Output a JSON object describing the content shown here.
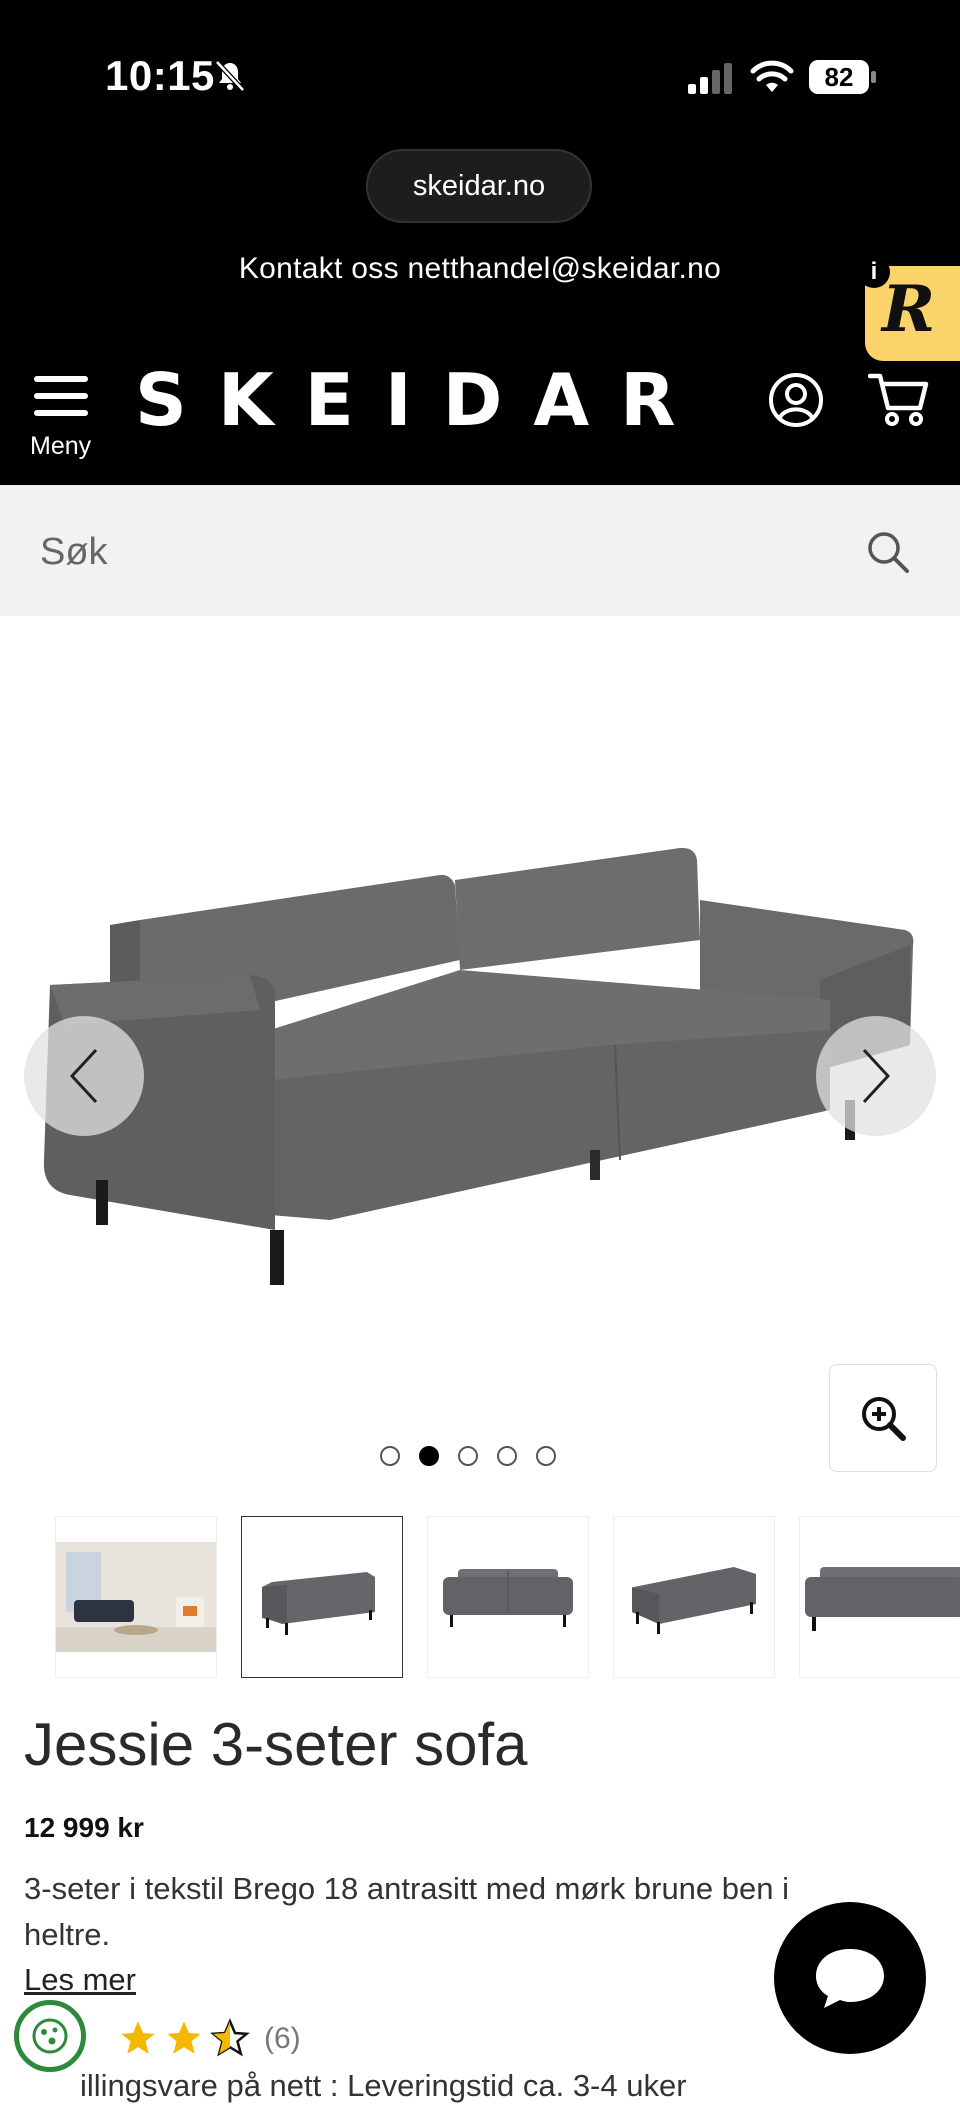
{
  "status_bar": {
    "time": "10:15",
    "battery": "82"
  },
  "browser": {
    "url": "skeidar.no"
  },
  "header": {
    "contact_text": "Kontakt oss netthandel@skeidar.no",
    "menu_label": "Meny",
    "logo": "SKEIDAR",
    "badge_letter": "R",
    "badge_info": "i"
  },
  "search": {
    "placeholder": "Søk"
  },
  "gallery": {
    "dots_count": 5,
    "active_index": 1
  },
  "product": {
    "title": "Jessie 3-seter sofa",
    "price": "12 999 kr",
    "description": "3-seter i tekstil Brego 18 antrasitt med mørk brune ben i heltre.",
    "read_more": "Les mer",
    "rating": 3.5,
    "review_count": "(6)",
    "delivery": "illingsvare på nett : Leveringstid ca. 3-4 uker"
  },
  "colors": {
    "header_bg": "#000000",
    "search_bg": "#f2f2f2",
    "star": "#f5b800",
    "badge": "#fbd36b",
    "eco_green": "#2c8a3a"
  }
}
